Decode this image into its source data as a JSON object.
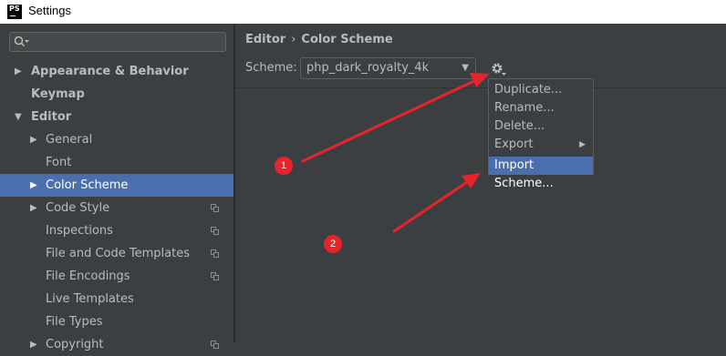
{
  "window": {
    "title": "Settings",
    "app_icon_text": "PS"
  },
  "sidebar": {
    "search": {
      "value": "",
      "placeholder": ""
    },
    "items": [
      {
        "label": "Appearance & Behavior"
      },
      {
        "label": "Keymap"
      },
      {
        "label": "Editor"
      },
      {
        "label": "General"
      },
      {
        "label": "Font"
      },
      {
        "label": "Color Scheme"
      },
      {
        "label": "Code Style"
      },
      {
        "label": "Inspections"
      },
      {
        "label": "File and Code Templates"
      },
      {
        "label": "File Encodings"
      },
      {
        "label": "Live Templates"
      },
      {
        "label": "File Types"
      },
      {
        "label": "Copyright"
      }
    ]
  },
  "main": {
    "breadcrumb": {
      "parent": "Editor",
      "separator": "›",
      "current": "Color Scheme"
    },
    "scheme": {
      "label": "Scheme:",
      "value": "php_dark_royalty_4k"
    }
  },
  "menu": {
    "items": [
      {
        "label": "Duplicate..."
      },
      {
        "label": "Rename..."
      },
      {
        "label": "Delete..."
      },
      {
        "label": "Export"
      },
      {
        "label": "Import Scheme..."
      }
    ],
    "highlighted": "Import Scheme..."
  },
  "annotations": {
    "badges": [
      {
        "label": "1"
      },
      {
        "label": "2"
      }
    ],
    "color": "#e8242b"
  },
  "colors": {
    "selection": "#4b6eaf",
    "background": "#3c3f41",
    "text": "#bbbbbb"
  }
}
